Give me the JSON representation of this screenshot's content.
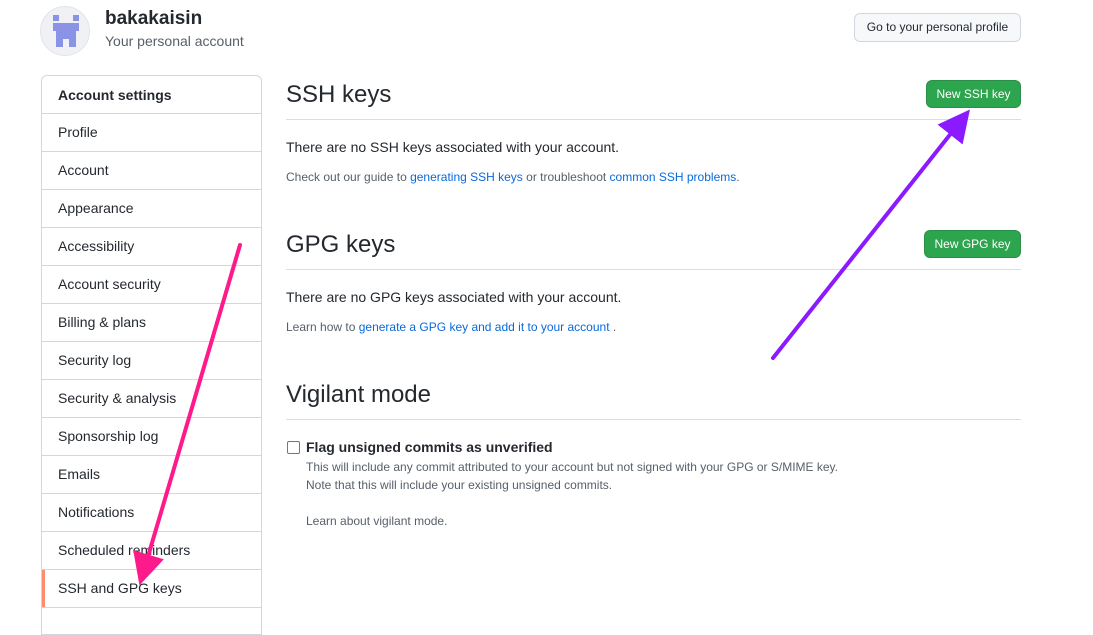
{
  "header": {
    "username": "bakakaisin",
    "subtitle": "Your personal account",
    "profile_button": "Go to your personal profile"
  },
  "sidebar": {
    "header": "Account settings",
    "items": [
      {
        "label": "Profile"
      },
      {
        "label": "Account"
      },
      {
        "label": "Appearance"
      },
      {
        "label": "Accessibility"
      },
      {
        "label": "Account security"
      },
      {
        "label": "Billing & plans"
      },
      {
        "label": "Security log"
      },
      {
        "label": "Security & analysis"
      },
      {
        "label": "Sponsorship log"
      },
      {
        "label": "Emails"
      },
      {
        "label": "Notifications"
      },
      {
        "label": "Scheduled reminders"
      },
      {
        "label": "SSH and GPG keys",
        "selected": true
      }
    ]
  },
  "ssh": {
    "title": "SSH keys",
    "new_button": "New SSH key",
    "empty_text": "There are no SSH keys associated with your account.",
    "guide_prefix": "Check out our guide to ",
    "guide_link": "generating SSH keys",
    "guide_middle": " or troubleshoot ",
    "problems_link": "common SSH problems",
    "guide_suffix": "."
  },
  "gpg": {
    "title": "GPG keys",
    "new_button": "New GPG key",
    "empty_text": "There are no GPG keys associated with your account.",
    "learn_prefix": "Learn how to ",
    "learn_link": "generate a GPG key and add it to your account",
    "learn_suffix": " ."
  },
  "vigilant": {
    "title": "Vigilant mode",
    "checkbox_label": "Flag unsigned commits as unverified",
    "checked": false,
    "note_line1": "This will include any commit attributed to your account but not signed with your GPG or S/MIME key.",
    "note_line2": "Note that this will include your existing unsigned commits.",
    "learn_link": "Learn about vigilant mode."
  },
  "colors": {
    "primary_button": "#2da44e",
    "link": "#0969da",
    "selected_marker": "#fd8c73",
    "annotation_pink": "#ff1a8c",
    "annotation_purple": "#8b1aff",
    "avatar_identicon": "#8a93e6"
  },
  "icons": {
    "avatar": "identicon"
  }
}
